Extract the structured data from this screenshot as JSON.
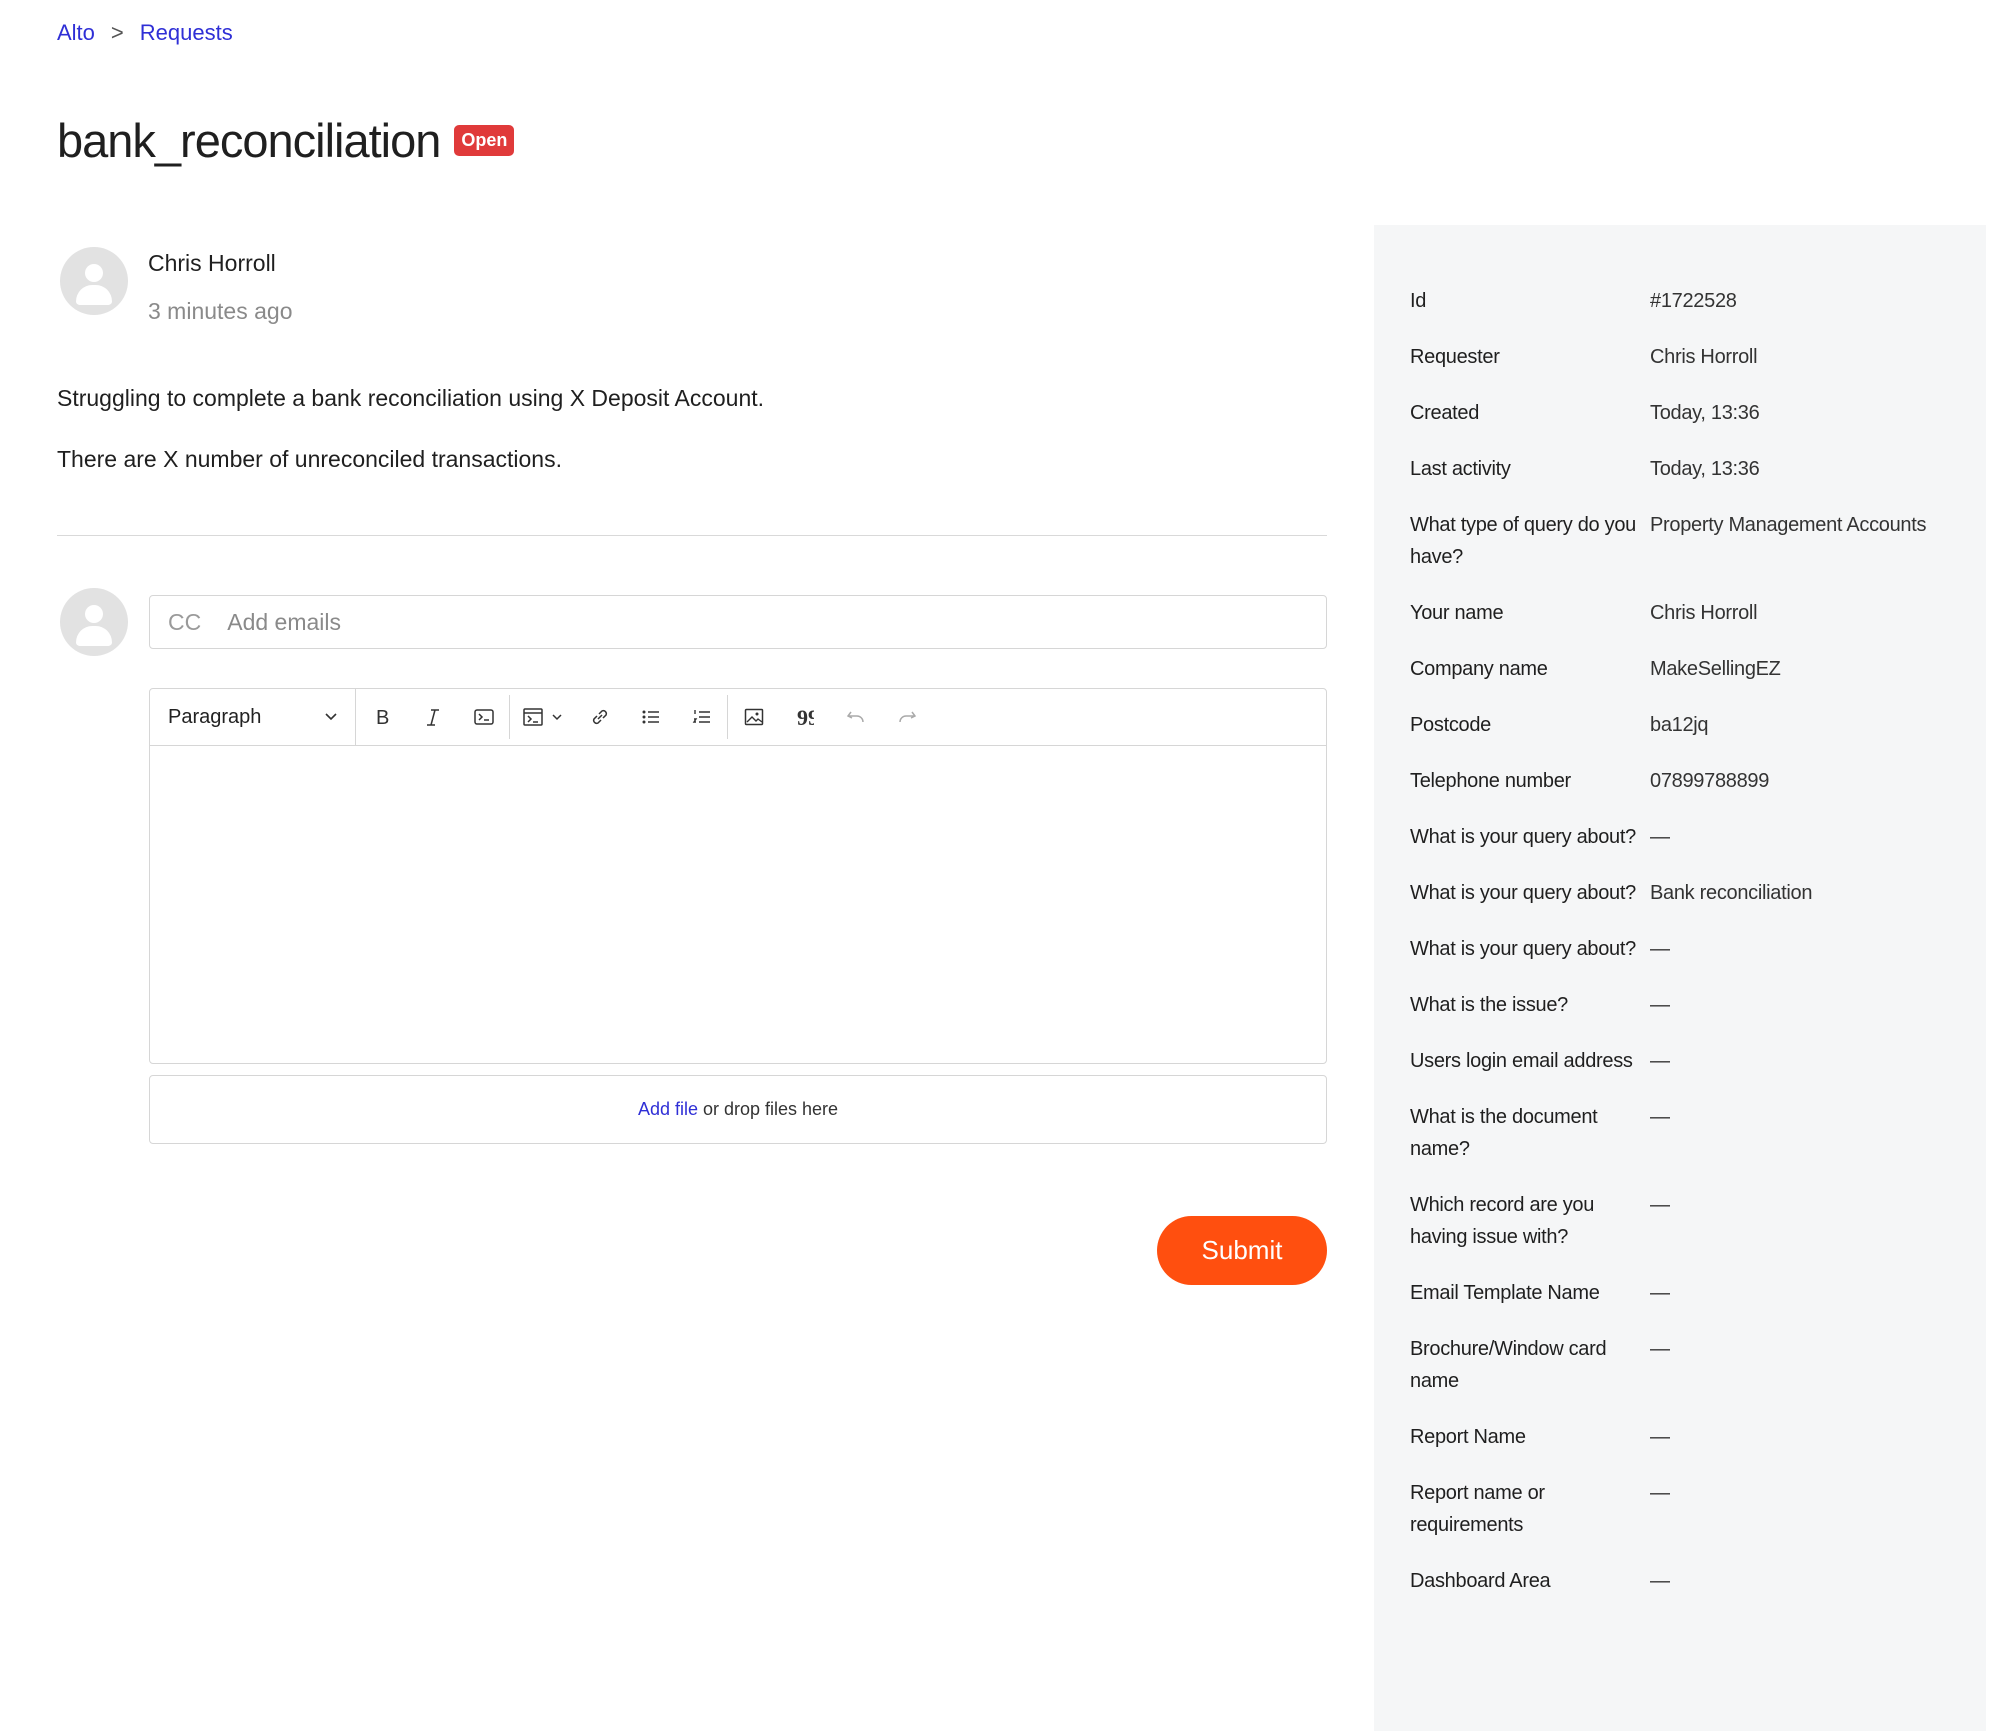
{
  "breadcrumb": {
    "root": "Alto",
    "separator": ">",
    "current": "Requests"
  },
  "request": {
    "title": "bank_reconciliation",
    "status": "Open"
  },
  "comment": {
    "author": "Chris Horroll",
    "time": "3 minutes ago",
    "paragraphs": [
      "Struggling to complete a bank reconciliation using X Deposit Account.",
      "There are X number of unreconciled transactions."
    ]
  },
  "reply": {
    "cc_label": "CC",
    "cc_placeholder": "Add emails",
    "format_select": "Paragraph",
    "dropzone": {
      "link": "Add file",
      "text": "or drop files here"
    },
    "submit": "Submit"
  },
  "properties": [
    {
      "key": "Id",
      "value": "#1722528"
    },
    {
      "key": "Requester",
      "value": "Chris Horroll"
    },
    {
      "key": "Created",
      "value": "Today, 13:36"
    },
    {
      "key": "Last activity",
      "value": "Today, 13:36"
    },
    {
      "key": "What type of query do you have?",
      "value": "Property Management Accounts"
    },
    {
      "key": "Your name",
      "value": "Chris Horroll"
    },
    {
      "key": "Company name",
      "value": "MakeSellingEZ"
    },
    {
      "key": "Postcode",
      "value": "ba12jq"
    },
    {
      "key": "Telephone number",
      "value": "07899788899"
    },
    {
      "key": "What is your query about?",
      "value": "—"
    },
    {
      "key": "What is your query about?",
      "value": "Bank reconciliation"
    },
    {
      "key": "What is your query about?",
      "value": "—"
    },
    {
      "key": "What is the issue?",
      "value": "—"
    },
    {
      "key": "Users login email address",
      "value": "—"
    },
    {
      "key": "What is the document name?",
      "value": "—"
    },
    {
      "key": "Which record are you having issue with?",
      "value": "—"
    },
    {
      "key": "Email Template Name",
      "value": "—"
    },
    {
      "key": "Brochure/Window card name",
      "value": "—"
    },
    {
      "key": "Report Name",
      "value": "—"
    },
    {
      "key": "Report name or requirements",
      "value": "—"
    },
    {
      "key": "Dashboard Area",
      "value": "—"
    }
  ],
  "icons": {
    "toolbar": [
      "chevron-down-icon",
      "bold-icon",
      "italic-icon",
      "code-icon",
      "code-block-icon",
      "link-icon",
      "bulleted-list-icon",
      "numbered-list-icon",
      "image-icon",
      "quote-icon",
      "undo-icon",
      "redo-icon"
    ]
  },
  "colors": {
    "link": "#2f2fd6",
    "badge": "#e03a3a",
    "submit": "#ff4f0f",
    "sidebar_bg": "#f5f6f7"
  }
}
